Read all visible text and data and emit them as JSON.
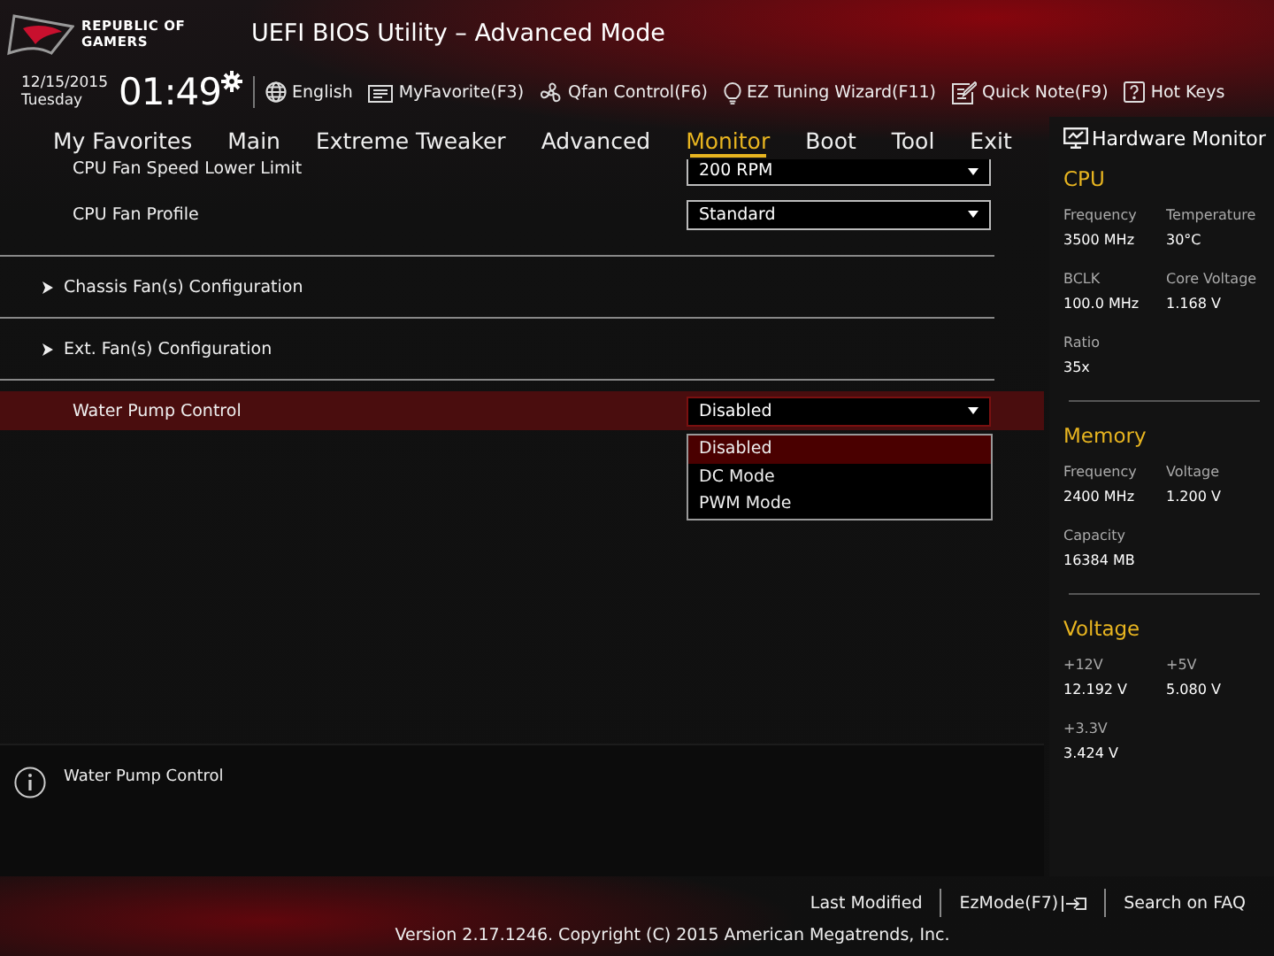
{
  "header": {
    "logo_text": "REPUBLIC OF GAMERS",
    "title": "UEFI BIOS Utility – Advanced Mode"
  },
  "toolbar": {
    "date": "12/15/2015",
    "day": "Tuesday",
    "time": "01:49",
    "items": [
      {
        "label": "English"
      },
      {
        "label": "MyFavorite(F3)"
      },
      {
        "label": "Qfan Control(F6)"
      },
      {
        "label": "EZ Tuning Wizard(F11)"
      },
      {
        "label": "Quick Note(F9)"
      },
      {
        "label": "Hot Keys"
      }
    ]
  },
  "tabs": [
    {
      "label": "My Favorites",
      "selected": false
    },
    {
      "label": "Main",
      "selected": false
    },
    {
      "label": "Extreme Tweaker",
      "selected": false
    },
    {
      "label": "Advanced",
      "selected": false
    },
    {
      "label": "Monitor",
      "selected": true
    },
    {
      "label": "Boot",
      "selected": false
    },
    {
      "label": "Tool",
      "selected": false
    },
    {
      "label": "Exit",
      "selected": false
    }
  ],
  "settings": [
    {
      "kind": "select",
      "label": "CPU Fan Speed Lower Limit",
      "value": "200 RPM",
      "highlighted": false
    },
    {
      "kind": "select",
      "label": "CPU Fan Profile",
      "value": "Standard",
      "highlighted": false
    },
    {
      "kind": "submenu",
      "label": "Chassis Fan(s) Configuration"
    },
    {
      "kind": "submenu",
      "label": "Ext. Fan(s) Configuration"
    },
    {
      "kind": "select",
      "label": "Water Pump Control",
      "value": "Disabled",
      "highlighted": true,
      "dropdown": {
        "options": [
          {
            "label": "Disabled",
            "selected": true
          },
          {
            "label": "DC Mode",
            "selected": false
          },
          {
            "label": "PWM Mode",
            "selected": false
          }
        ]
      }
    }
  ],
  "help": {
    "text": "Water Pump Control"
  },
  "hardware_monitor": {
    "title": "Hardware Monitor",
    "sections": [
      {
        "title": "CPU",
        "items": [
          {
            "label": "Frequency",
            "value": "3500 MHz"
          },
          {
            "label": "Temperature",
            "value": "30°C"
          },
          {
            "label": "BCLK",
            "value": "100.0 MHz"
          },
          {
            "label": "Core Voltage",
            "value": "1.168 V"
          },
          {
            "label": "Ratio",
            "value": "35x"
          }
        ]
      },
      {
        "title": "Memory",
        "items": [
          {
            "label": "Frequency",
            "value": "2400 MHz"
          },
          {
            "label": "Voltage",
            "value": "1.200 V"
          },
          {
            "label": "Capacity",
            "value": "16384 MB"
          }
        ]
      },
      {
        "title": "Voltage",
        "items": [
          {
            "label": "+12V",
            "value": "12.192 V"
          },
          {
            "label": "+5V",
            "value": "5.080 V"
          },
          {
            "label": "+3.3V",
            "value": "3.424 V"
          }
        ]
      }
    ]
  },
  "footer": {
    "links": [
      {
        "label": "Last Modified"
      },
      {
        "label": "EzMode(F7)"
      },
      {
        "label": "Search on FAQ"
      }
    ],
    "version": "Version 2.17.1246. Copyright (C) 2015 American Megatrends, Inc."
  }
}
